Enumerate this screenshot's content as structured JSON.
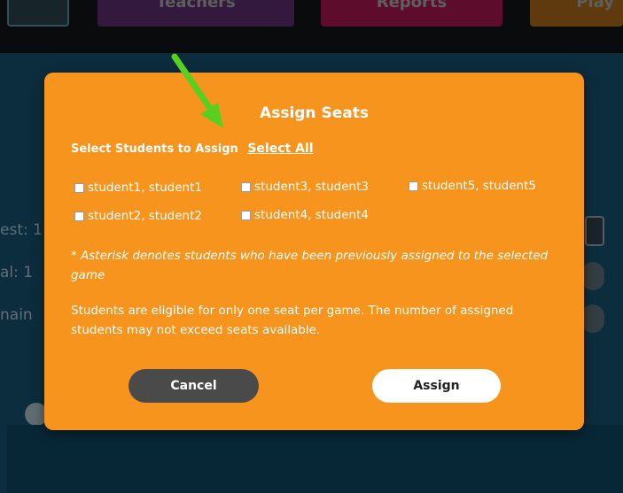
{
  "top_nav": {
    "tabs": [
      {
        "label": ""
      },
      {
        "label": "Teachers"
      },
      {
        "label": "Reports"
      },
      {
        "label": "Play"
      }
    ]
  },
  "background": {
    "labels": [
      "est: 1",
      "al: 1",
      "nain"
    ]
  },
  "modal": {
    "title": "Assign Seats",
    "select_prompt": "Select Students to Assign",
    "select_all_label": "Select All",
    "students": [
      {
        "label": "student1, student1",
        "checked": false
      },
      {
        "label": "student3, student3",
        "checked": false
      },
      {
        "label": "student5, student5",
        "checked": false
      },
      {
        "label": "student2, student2",
        "checked": false
      },
      {
        "label": "student4, student4",
        "checked": false
      }
    ],
    "asterisk_note": "* Asterisk denotes students who have been previously assigned to the selected game",
    "eligibility_info": "Students are eligible for only one seat per game. The number of assigned students may not exceed seats available.",
    "cancel_label": "Cancel",
    "assign_label": "Assign"
  },
  "colors": {
    "modal_bg": "#f7941e",
    "cancel_bg": "#4a4a4a",
    "assign_bg": "#ffffff",
    "arrow": "#58d01f"
  }
}
